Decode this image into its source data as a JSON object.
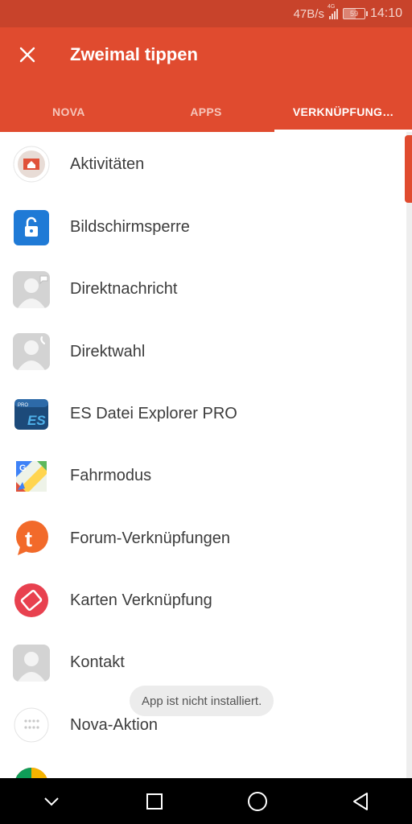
{
  "status_bar": {
    "net_speed": "47B/s",
    "network_type": "4G",
    "battery": "59",
    "battery_level_percent": 59,
    "time": "14:10"
  },
  "app_bar": {
    "title": "Zweimal tippen",
    "close_icon": "close-icon",
    "color": "#e04b2f"
  },
  "tabs": [
    {
      "label": "NOVA",
      "active": false
    },
    {
      "label": "APPS",
      "active": false
    },
    {
      "label": "VERKNÜPFUNG…",
      "active": true
    }
  ],
  "list": {
    "items": [
      {
        "label": "Aktivitäten",
        "icon": "activities-icon"
      },
      {
        "label": "Bildschirmsperre",
        "icon": "screen-lock-icon"
      },
      {
        "label": "Direktnachricht",
        "icon": "direct-message-contact-icon"
      },
      {
        "label": "Direktwahl",
        "icon": "direct-dial-contact-icon"
      },
      {
        "label": "ES Datei Explorer PRO",
        "icon": "es-file-explorer-icon"
      },
      {
        "label": "Fahrmodus",
        "icon": "driving-mode-maps-icon"
      },
      {
        "label": "Forum-Verknüpfungen",
        "icon": "tapatalk-forum-icon"
      },
      {
        "label": "Karten Verknüpfung",
        "icon": "card-shortcut-icon"
      },
      {
        "label": "Kontakt",
        "icon": "contact-icon"
      },
      {
        "label": "Nova-Aktion",
        "icon": "nova-action-icon"
      }
    ]
  },
  "toast": {
    "message": "App ist nicht installiert."
  },
  "nav_bar": {
    "buttons": [
      "collapse-chevron-icon",
      "recents-square-icon",
      "home-circle-icon",
      "back-triangle-icon"
    ]
  }
}
